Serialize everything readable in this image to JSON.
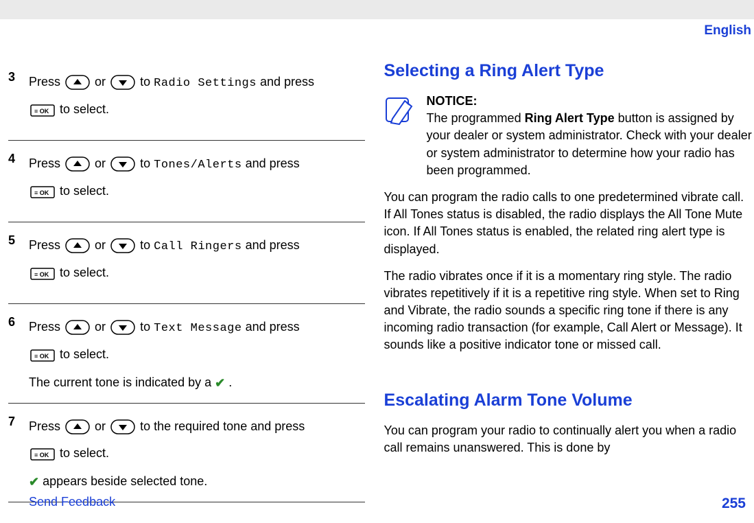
{
  "header": {
    "language": "English"
  },
  "steps": [
    {
      "num": "3",
      "press": "Press",
      "or": "or",
      "to": "to",
      "target": "Radio Settings",
      "andpress": "and press",
      "toselect": "to select."
    },
    {
      "num": "4",
      "press": "Press",
      "or": "or",
      "to": "to",
      "target": "Tones/Alerts",
      "andpress": "and press",
      "toselect": "to select."
    },
    {
      "num": "5",
      "press": "Press",
      "or": "or",
      "to": "to",
      "target": "Call Ringers",
      "andpress": "and press",
      "toselect": "to select."
    },
    {
      "num": "6",
      "press": "Press",
      "or": "or",
      "to": "to",
      "target": "Text Message",
      "andpress": "and press",
      "toselect": "to select.",
      "extra_pre": "The current tone is indicated by a",
      "extra_post": "."
    },
    {
      "num": "7",
      "press": "Press",
      "or": "or",
      "to_text": "to the required tone and press",
      "toselect": "to select.",
      "extra2": "appears beside selected tone."
    }
  ],
  "right": {
    "section1_title": "Selecting a Ring Alert Type",
    "notice_label": "NOTICE:",
    "notice_text_pre": "The programmed ",
    "notice_bold": "Ring Alert Type",
    "notice_text_post": " button is assigned by your dealer or system administrator. Check with your dealer or system administrator to determine how your radio has been programmed.",
    "para1": "You can program the radio calls to one predetermined vibrate call. If All Tones status is disabled, the radio displays the All Tone Mute icon. If All Tones status is enabled, the related ring alert type is displayed.",
    "para2": "The radio vibrates once if it is a momentary ring style. The radio vibrates repetitively if it is a repetitive ring style. When set to Ring and Vibrate, the radio sounds a specific ring tone if there is any incoming radio transaction (for example, Call Alert or Message). It sounds like a positive indicator tone or missed call.",
    "section2_title": "Escalating Alarm Tone Volume",
    "para3": "You can program your radio to continually alert you when a radio call remains unanswered. This is done by"
  },
  "footer": {
    "feedback": "Send Feedback",
    "page": "255"
  }
}
